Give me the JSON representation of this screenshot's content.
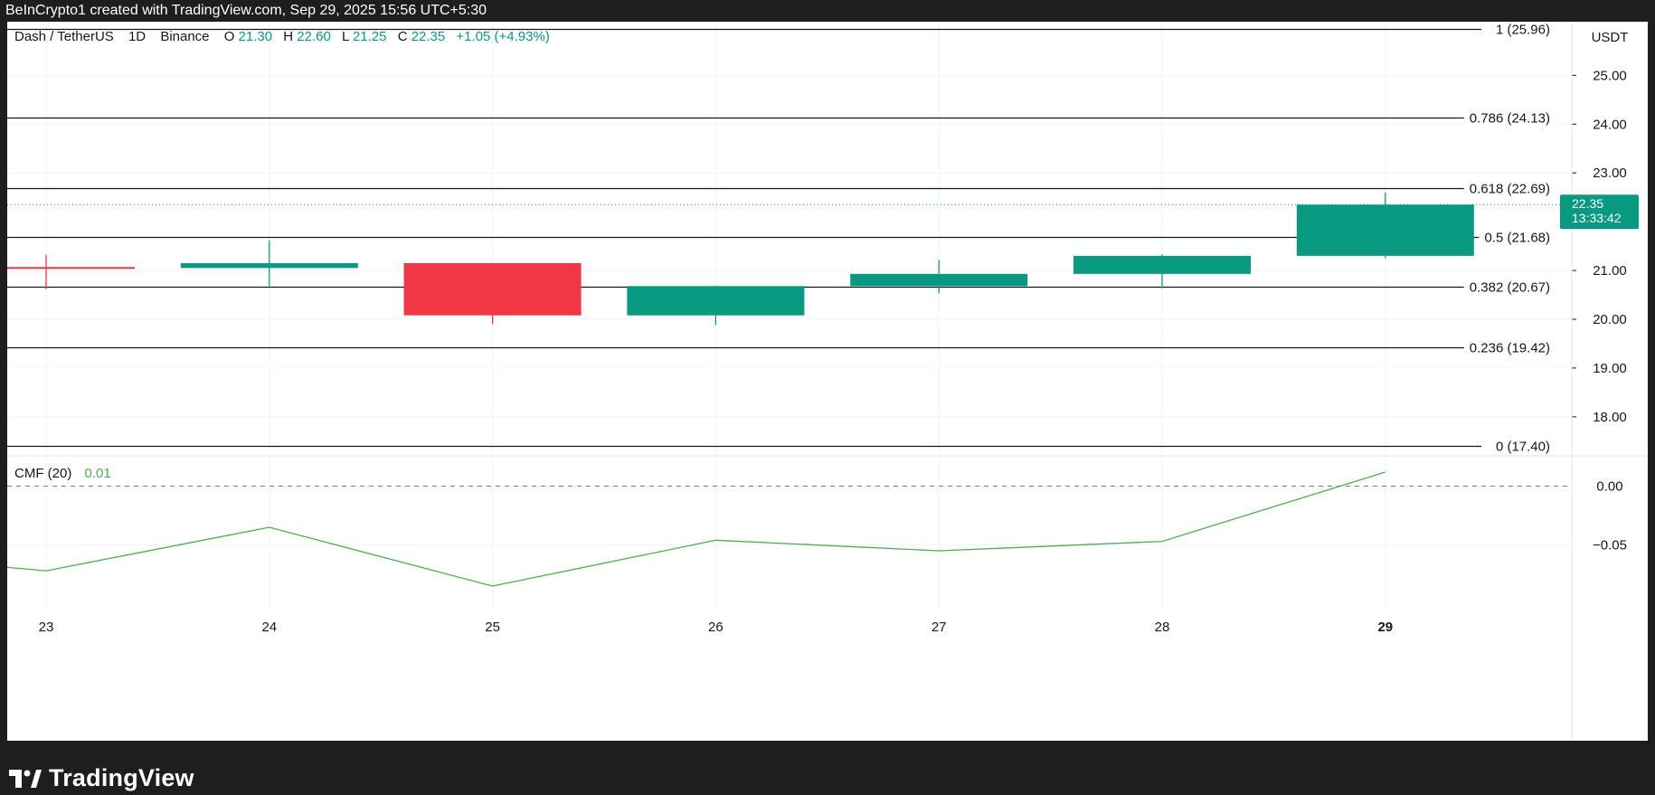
{
  "header": {
    "caption": "BeInCrypto1 created with TradingView.com, Sep 29, 2025 15:56 UTC+5:30"
  },
  "footer": {
    "brand": "TradingView"
  },
  "colors": {
    "up": "#089981",
    "down": "#f23645",
    "cmf_line": "#4caf50",
    "grid": "#f0f3fa",
    "fib_line": "#131722"
  },
  "chart_data": [
    {
      "type": "candlestick",
      "legend": {
        "symbol": "Dash / TetherUS",
        "interval": "1D",
        "exchange": "Binance",
        "open_label": "O",
        "open": "21.30",
        "high_label": "H",
        "high": "22.60",
        "low_label": "L",
        "low": "21.25",
        "close_label": "C",
        "close": "22.35",
        "change": "+1.05 (+4.93%)"
      },
      "currency": "USDT",
      "x": [
        "23",
        "24",
        "25",
        "26",
        "27",
        "28",
        "29"
      ],
      "candles": [
        {
          "x": "23",
          "o": 21.07,
          "h": 21.32,
          "l": 20.62,
          "c": 21.05
        },
        {
          "x": "24",
          "o": 21.05,
          "h": 21.62,
          "l": 20.68,
          "c": 21.15
        },
        {
          "x": "25",
          "o": 21.15,
          "h": 21.15,
          "l": 19.9,
          "c": 20.08
        },
        {
          "x": "26",
          "o": 20.08,
          "h": 20.68,
          "l": 19.88,
          "c": 20.68
        },
        {
          "x": "27",
          "o": 20.68,
          "h": 21.22,
          "l": 20.53,
          "c": 20.93
        },
        {
          "x": "28",
          "o": 20.93,
          "h": 21.33,
          "l": 20.64,
          "c": 21.3
        },
        {
          "x": "29",
          "o": 21.3,
          "h": 22.6,
          "l": 21.25,
          "c": 22.35
        }
      ],
      "yticks": [
        "25.00",
        "24.00",
        "23.00",
        "21.00",
        "20.00",
        "19.00",
        "18.00"
      ],
      "ylim": [
        17.2,
        26.1
      ],
      "fib_levels": [
        {
          "label": "1 (25.96)",
          "value": 25.96
        },
        {
          "label": "0.786 (24.13)",
          "value": 24.13
        },
        {
          "label": "0.618 (22.69)",
          "value": 22.69
        },
        {
          "label": "0.5 (21.68)",
          "value": 21.68
        },
        {
          "label": "0.382 (20.67)",
          "value": 20.67
        },
        {
          "label": "0.236 (19.42)",
          "value": 19.42
        },
        {
          "label": "0 (17.40)",
          "value": 17.4
        }
      ],
      "last_price": {
        "price": "22.35",
        "countdown": "13:33:42",
        "value": 22.35
      },
      "grid": true
    },
    {
      "type": "line",
      "legend": {
        "name": "CMF (20)",
        "value": "0.01"
      },
      "x": [
        "22",
        "23",
        "24",
        "25",
        "26",
        "27",
        "28",
        "29"
      ],
      "values": [
        -0.055,
        -0.072,
        -0.035,
        -0.085,
        -0.046,
        -0.055,
        -0.047,
        0.012
      ],
      "yticks": [
        "0.00",
        "−0.05"
      ],
      "ylim": [
        -0.105,
        0.025
      ],
      "zero_line": "dashed"
    }
  ]
}
